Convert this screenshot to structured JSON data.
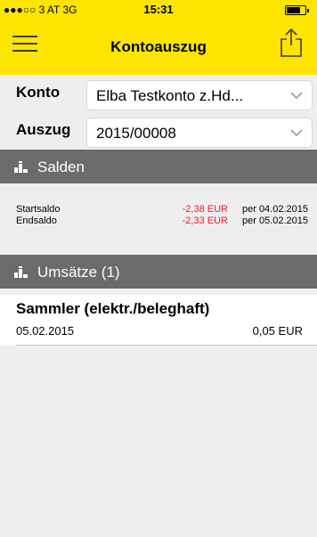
{
  "status_bar": {
    "carrier": "●●●○○ 3 AT  3G",
    "time": "15:31"
  },
  "navbar": {
    "title": "Kontoauszug",
    "menu_icon": "hamburger-menu-icon",
    "share_icon": "share-icon"
  },
  "form": {
    "konto_label": "Konto",
    "konto_value": "Elba Testkonto z.Hd...",
    "auszug_label": "Auszug",
    "auszug_value": "2015/00008"
  },
  "salden": {
    "header": "Salden",
    "rows": [
      {
        "label": "Startsaldo",
        "amount": "-2,38 EUR",
        "date": "per 04.02.2015"
      },
      {
        "label": "Endsaldo",
        "amount": "-2,33 EUR",
        "date": "per 05.02.2015"
      }
    ]
  },
  "umsaetze": {
    "header": "Umsätze (1)",
    "items": [
      {
        "title": "Sammler (elektr./beleghaft)",
        "date": "05.02.2015",
        "amount": "0,05 EUR"
      }
    ]
  },
  "colors": {
    "brand_yellow": "#fde500",
    "section_gray": "#6b6b6b",
    "negative_red": "#e8202a",
    "background": "#eeeeef"
  }
}
